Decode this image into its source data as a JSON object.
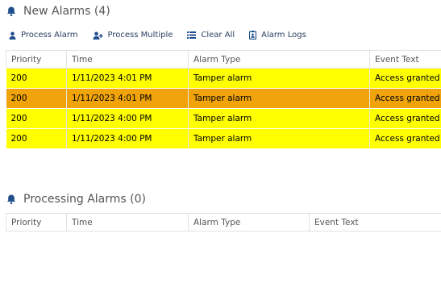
{
  "new_alarms": {
    "title": "New Alarms (4)",
    "columns": [
      "Priority",
      "Time",
      "Alarm Type",
      "Event Text"
    ],
    "rows": [
      {
        "priority": "200",
        "time": "1/11/2023 4:01 PM",
        "alarm_type": "Tamper alarm",
        "event_text": "Access granted",
        "color": "#ffff00"
      },
      {
        "priority": "200",
        "time": "1/11/2023 4:01 PM",
        "alarm_type": "Tamper alarm",
        "event_text": "Access granted",
        "color": "#f0a30a"
      },
      {
        "priority": "200",
        "time": "1/11/2023 4:00 PM",
        "alarm_type": "Tamper alarm",
        "event_text": "Access granted",
        "color": "#ffff00"
      },
      {
        "priority": "200",
        "time": "1/11/2023 4:00 PM",
        "alarm_type": "Tamper alarm",
        "event_text": "Access granted",
        "color": "#ffff00"
      }
    ]
  },
  "toolbar": {
    "process_alarm": "Process Alarm",
    "process_multiple": "Process Multiple",
    "clear_all": "Clear All",
    "alarm_logs": "Alarm Logs"
  },
  "processing_alarms": {
    "title": "Processing Alarms (0)",
    "columns": [
      "Priority",
      "Time",
      "Alarm Type",
      "Event Text"
    ]
  },
  "colors": {
    "accent": "#1f4e8c",
    "highlight_yellow": "#ffff00",
    "highlight_orange": "#f0a30a"
  }
}
